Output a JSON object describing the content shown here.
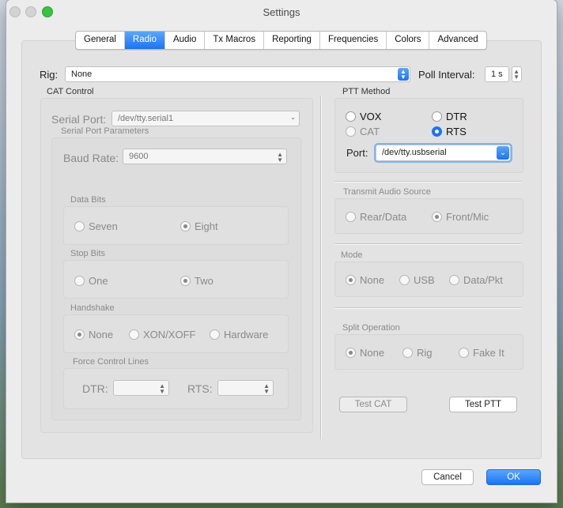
{
  "window": {
    "title": "Settings"
  },
  "tabs": [
    "General",
    "Radio",
    "Audio",
    "Tx Macros",
    "Reporting",
    "Frequencies",
    "Colors",
    "Advanced"
  ],
  "rig": {
    "label": "Rig:",
    "value": "None"
  },
  "poll": {
    "label": "Poll Interval:",
    "value": "1 s"
  },
  "cat": {
    "title": "CAT Control",
    "serial_port_label": "Serial Port:",
    "serial_port_value": "/dev/tty.serial1",
    "params_title": "Serial Port Parameters",
    "baud_label": "Baud Rate:",
    "baud_value": "9600",
    "data_bits": {
      "title": "Data Bits",
      "options": [
        "Seven",
        "Eight"
      ],
      "selected": "Eight"
    },
    "stop_bits": {
      "title": "Stop Bits",
      "options": [
        "One",
        "Two"
      ],
      "selected": "Two"
    },
    "handshake": {
      "title": "Handshake",
      "options": [
        "None",
        "XON/XOFF",
        "Hardware"
      ],
      "selected": "None"
    },
    "force": {
      "title": "Force Control Lines",
      "dtr_label": "DTR:",
      "rts_label": "RTS:"
    }
  },
  "ptt": {
    "title": "PTT Method",
    "options": [
      "VOX",
      "DTR",
      "CAT",
      "RTS"
    ],
    "selected": "RTS",
    "port_label": "Port:",
    "port_value": "/dev/tty.usbserial"
  },
  "tx_audio": {
    "title": "Transmit Audio Source",
    "options": [
      "Rear/Data",
      "Front/Mic"
    ],
    "selected": "Front/Mic"
  },
  "mode": {
    "title": "Mode",
    "options": [
      "None",
      "USB",
      "Data/Pkt"
    ],
    "selected": "None"
  },
  "split": {
    "title": "Split Operation",
    "options": [
      "None",
      "Rig",
      "Fake It"
    ],
    "selected": "None"
  },
  "buttons": {
    "test_cat": "Test CAT",
    "test_ptt": "Test PTT",
    "cancel": "Cancel",
    "ok": "OK"
  },
  "colors": {
    "accent": "#1b74f0",
    "green": "#37c33f"
  }
}
